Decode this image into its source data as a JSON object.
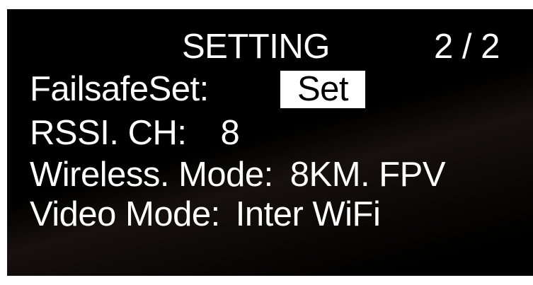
{
  "screen": {
    "title": "SETTING",
    "page_indicator": "2 / 2"
  },
  "settings": {
    "failsafe": {
      "label": "FailsafeSet:",
      "value": "Set"
    },
    "rssi_ch": {
      "label": "RSSI. CH:",
      "value": "8"
    },
    "wireless_mode": {
      "label": "Wireless. Mode:",
      "value": "8KM. FPV"
    },
    "video_mode": {
      "label": "Video Mode:",
      "value": "Inter WiFi"
    }
  },
  "colors": {
    "background": "#000000",
    "text": "#ffffff",
    "highlight_bg": "#ffffff",
    "highlight_text": "#000000"
  }
}
